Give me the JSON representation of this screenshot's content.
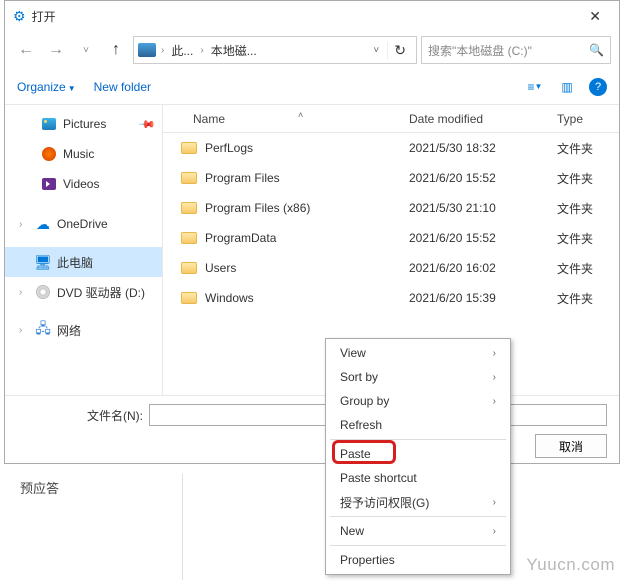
{
  "titlebar": {
    "title": "打开"
  },
  "breadcrumb": {
    "item1": "此...",
    "item2": "本地磁..."
  },
  "search": {
    "placeholder": "搜索\"本地磁盘 (C:)\""
  },
  "toolbar": {
    "organize": "Organize",
    "newfolder": "New folder"
  },
  "columns": {
    "name": "Name",
    "date": "Date modified",
    "type": "Type"
  },
  "sidebar": {
    "pictures": "Pictures",
    "music": "Music",
    "videos": "Videos",
    "onedrive": "OneDrive",
    "thispc": "此电脑",
    "dvd": "DVD 驱动器 (D:)",
    "network": "网络"
  },
  "files": [
    {
      "name": "PerfLogs",
      "date": "2021/5/30 18:32",
      "type": "文件夹"
    },
    {
      "name": "Program Files",
      "date": "2021/6/20 15:52",
      "type": "文件夹"
    },
    {
      "name": "Program Files (x86)",
      "date": "2021/5/30 21:10",
      "type": "文件夹"
    },
    {
      "name": "ProgramData",
      "date": "2021/6/20 15:52",
      "type": "文件夹"
    },
    {
      "name": "Users",
      "date": "2021/6/20 16:02",
      "type": "文件夹"
    },
    {
      "name": "Windows",
      "date": "2021/6/20 15:39",
      "type": "文件夹"
    }
  ],
  "filename": {
    "label": "文件名(N):"
  },
  "buttons": {
    "cancel": "取消"
  },
  "context_menu": {
    "view": "View",
    "sortby": "Sort by",
    "groupby": "Group by",
    "refresh": "Refresh",
    "paste": "Paste",
    "paste_shortcut": "Paste shortcut",
    "grant_access": "授予访问权限(G)",
    "new": "New",
    "properties": "Properties"
  },
  "below": "预应答",
  "watermark": "Yuucn.com"
}
